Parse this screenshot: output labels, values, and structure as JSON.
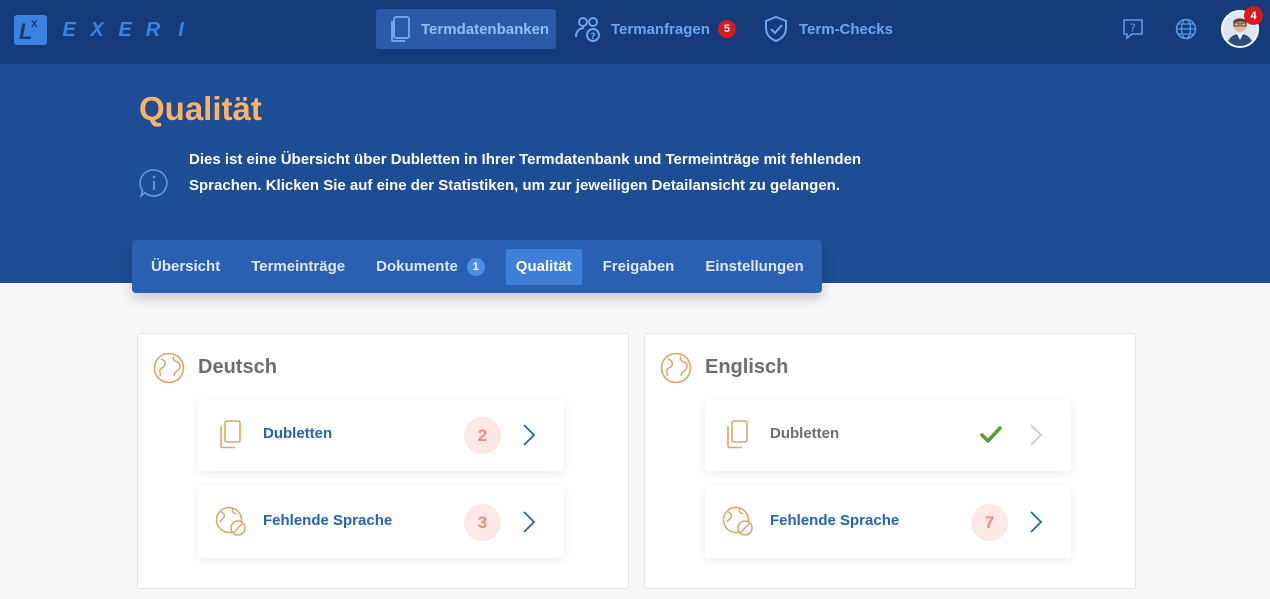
{
  "header": {
    "logo_letters": [
      "L",
      "E",
      "X",
      "E",
      "R",
      "I"
    ],
    "nav": [
      {
        "label": "Termdatenbanken",
        "active": true
      },
      {
        "label": "Termanfragen",
        "badge": "5"
      },
      {
        "label": "Term-Checks"
      }
    ],
    "avatar_badge": "4"
  },
  "page": {
    "title": "Qualität",
    "info": "Dies ist eine Übersicht über Dubletten in Ihrer Termdatenbank und Termeinträge mit fehlenden Sprachen. Klicken Sie auf eine der Statistiken, um zur jeweiligen Detailansicht zu gelangen."
  },
  "tabs": [
    {
      "label": "Übersicht"
    },
    {
      "label": "Termeinträge"
    },
    {
      "label": "Dokumente",
      "badge": "1"
    },
    {
      "label": "Qualität",
      "active": true
    },
    {
      "label": "Freigaben"
    },
    {
      "label": "Einstellungen"
    }
  ],
  "cards": [
    {
      "title": "Deutsch",
      "rows": [
        {
          "label": "Dubletten",
          "count": "2"
        },
        {
          "label": "Fehlende Sprache",
          "count": "3"
        }
      ]
    },
    {
      "title": "Englisch",
      "rows": [
        {
          "label": "Dubletten",
          "status": "check-icon"
        },
        {
          "label": "Fehlende Sprache",
          "count": "7"
        }
      ]
    }
  ],
  "colors": {
    "topbar": "#163b7a",
    "hero": "#1d4d94",
    "accent_orange": "#ffb266",
    "link_blue": "#2563b3",
    "badge_red": "#d91a1a",
    "count_bg": "#fde8e6",
    "count_text": "#f08a7d",
    "check_green": "#5aa02c"
  }
}
